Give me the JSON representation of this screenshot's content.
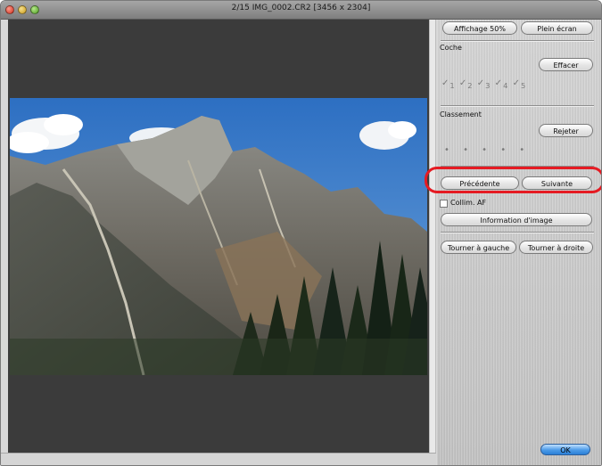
{
  "window": {
    "title": "2/15 IMG_0002.CR2 [3456 x 2304]"
  },
  "toolbar": {
    "view50_label": "Affichage 50%",
    "fullscreen_label": "Plein écran"
  },
  "check": {
    "section_label": "Coche",
    "clear_label": "Effacer",
    "marks": [
      "1",
      "2",
      "3",
      "4",
      "5"
    ]
  },
  "rating": {
    "section_label": "Classement",
    "reject_label": "Rejeter",
    "stars_glyph": "• • • • •"
  },
  "navigation": {
    "previous_label": "Précédente",
    "next_label": "Suivante"
  },
  "af": {
    "checkbox_label": "Collim. AF",
    "checked": false
  },
  "info": {
    "button_label": "Information d'image"
  },
  "rotate": {
    "left_label": "Tourner à gauche",
    "right_label": "Tourner à droite"
  },
  "footer": {
    "ok_label": "OK"
  },
  "colors": {
    "highlight": "#e51b23",
    "ok_button": "#3a8de0"
  }
}
